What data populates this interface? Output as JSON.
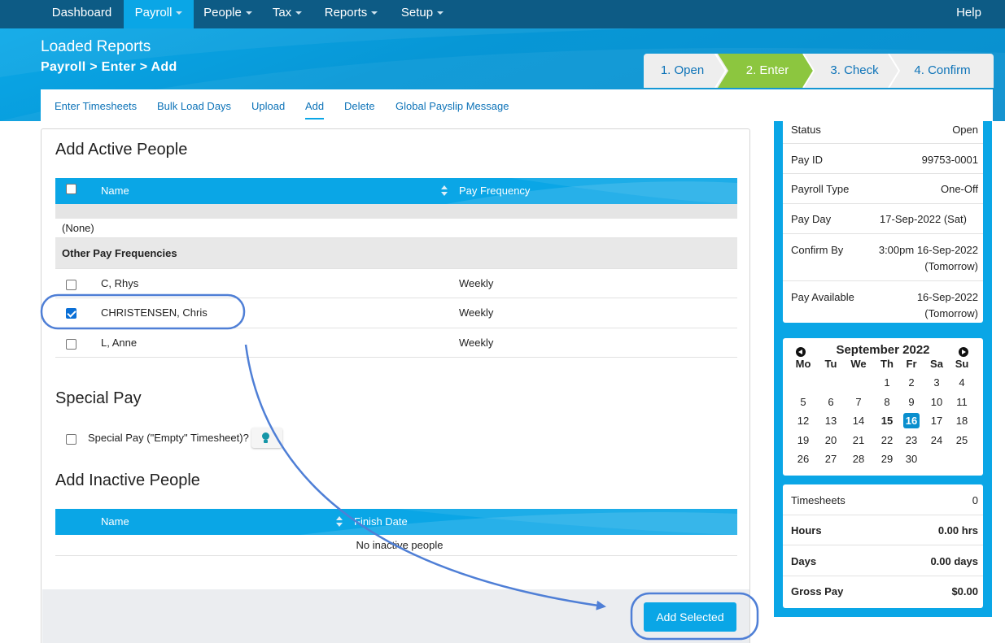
{
  "nav": {
    "items": [
      {
        "label": "Dashboard",
        "caret": false
      },
      {
        "label": "Payroll",
        "caret": true
      },
      {
        "label": "People",
        "caret": true
      },
      {
        "label": "Tax",
        "caret": true
      },
      {
        "label": "Reports",
        "caret": true
      },
      {
        "label": "Setup",
        "caret": true
      }
    ],
    "help": "Help",
    "active_color": "#0aa6e6",
    "bar_color": "#0d5b85"
  },
  "header": {
    "title": "Loaded Reports",
    "breadcrumb": "Payroll > Enter > Add"
  },
  "stepper": {
    "steps": [
      "1. Open",
      "2. Enter",
      "3. Check",
      "4. Confirm"
    ],
    "active_index": 1,
    "active_color": "#8cc63f"
  },
  "subnav": {
    "tabs": [
      "Enter Timesheets",
      "Bulk Load Days",
      "Upload",
      "Add",
      "Delete",
      "Global Payslip Message"
    ],
    "active": "Add"
  },
  "active_people": {
    "heading": "Add Active People",
    "columns": {
      "name": "Name",
      "frequency": "Pay Frequency"
    },
    "none_label": "(None)",
    "group_label": "Other Pay Frequencies",
    "rows": [
      {
        "name": "C, Rhys",
        "frequency": "Weekly",
        "checked": false
      },
      {
        "name": "CHRISTENSEN, Chris",
        "frequency": "Weekly",
        "checked": true
      },
      {
        "name": "L, Anne",
        "frequency": "Weekly",
        "checked": false
      }
    ]
  },
  "special_pay": {
    "heading": "Special Pay",
    "label": "Special Pay (\"Empty\" Timesheet)?",
    "icon": "lightbulb-icon"
  },
  "inactive_people": {
    "heading": "Add Inactive People",
    "columns": {
      "name": "Name",
      "finish": "Finish Date"
    },
    "empty": "No inactive people"
  },
  "actions": {
    "add_selected": "Add Selected"
  },
  "summary": {
    "rows": [
      {
        "label": "Status",
        "value": "Open"
      },
      {
        "label": "Pay ID",
        "value": "99753-0001"
      },
      {
        "label": "Payroll Type",
        "value": "One-Off"
      },
      {
        "label": "Pay Day",
        "value": "17-Sep-2022 (Sat)"
      },
      {
        "label": "Confirm By",
        "value": "3:00pm 16-Sep-2022",
        "value2": "(Tomorrow)"
      },
      {
        "label": "Pay Available",
        "value": "16-Sep-2022",
        "value2": "(Tomorrow)"
      }
    ]
  },
  "calendar": {
    "title": "September 2022",
    "dow": [
      "Mo",
      "Tu",
      "We",
      "Th",
      "Fr",
      "Sa",
      "Su"
    ],
    "weeks": [
      [
        "",
        "",
        "",
        "1",
        "2",
        "3",
        "4"
      ],
      [
        "5",
        "6",
        "7",
        "8",
        "9",
        "10",
        "11"
      ],
      [
        "12",
        "13",
        "14",
        "15",
        "16",
        "17",
        "18"
      ],
      [
        "19",
        "20",
        "21",
        "22",
        "23",
        "24",
        "25"
      ],
      [
        "26",
        "27",
        "28",
        "29",
        "30",
        "",
        ""
      ]
    ],
    "today": "15",
    "selected": "16"
  },
  "totals": {
    "rows": [
      {
        "label": "Timesheets",
        "value": "0",
        "bold": false
      },
      {
        "label": "Hours",
        "value": "0.00 hrs",
        "bold": true
      },
      {
        "label": "Days",
        "value": "0.00 days",
        "bold": true
      },
      {
        "label": "Gross Pay",
        "value": "$0.00",
        "bold": true
      }
    ]
  },
  "annotation": {
    "color": "#4f7fd6"
  }
}
